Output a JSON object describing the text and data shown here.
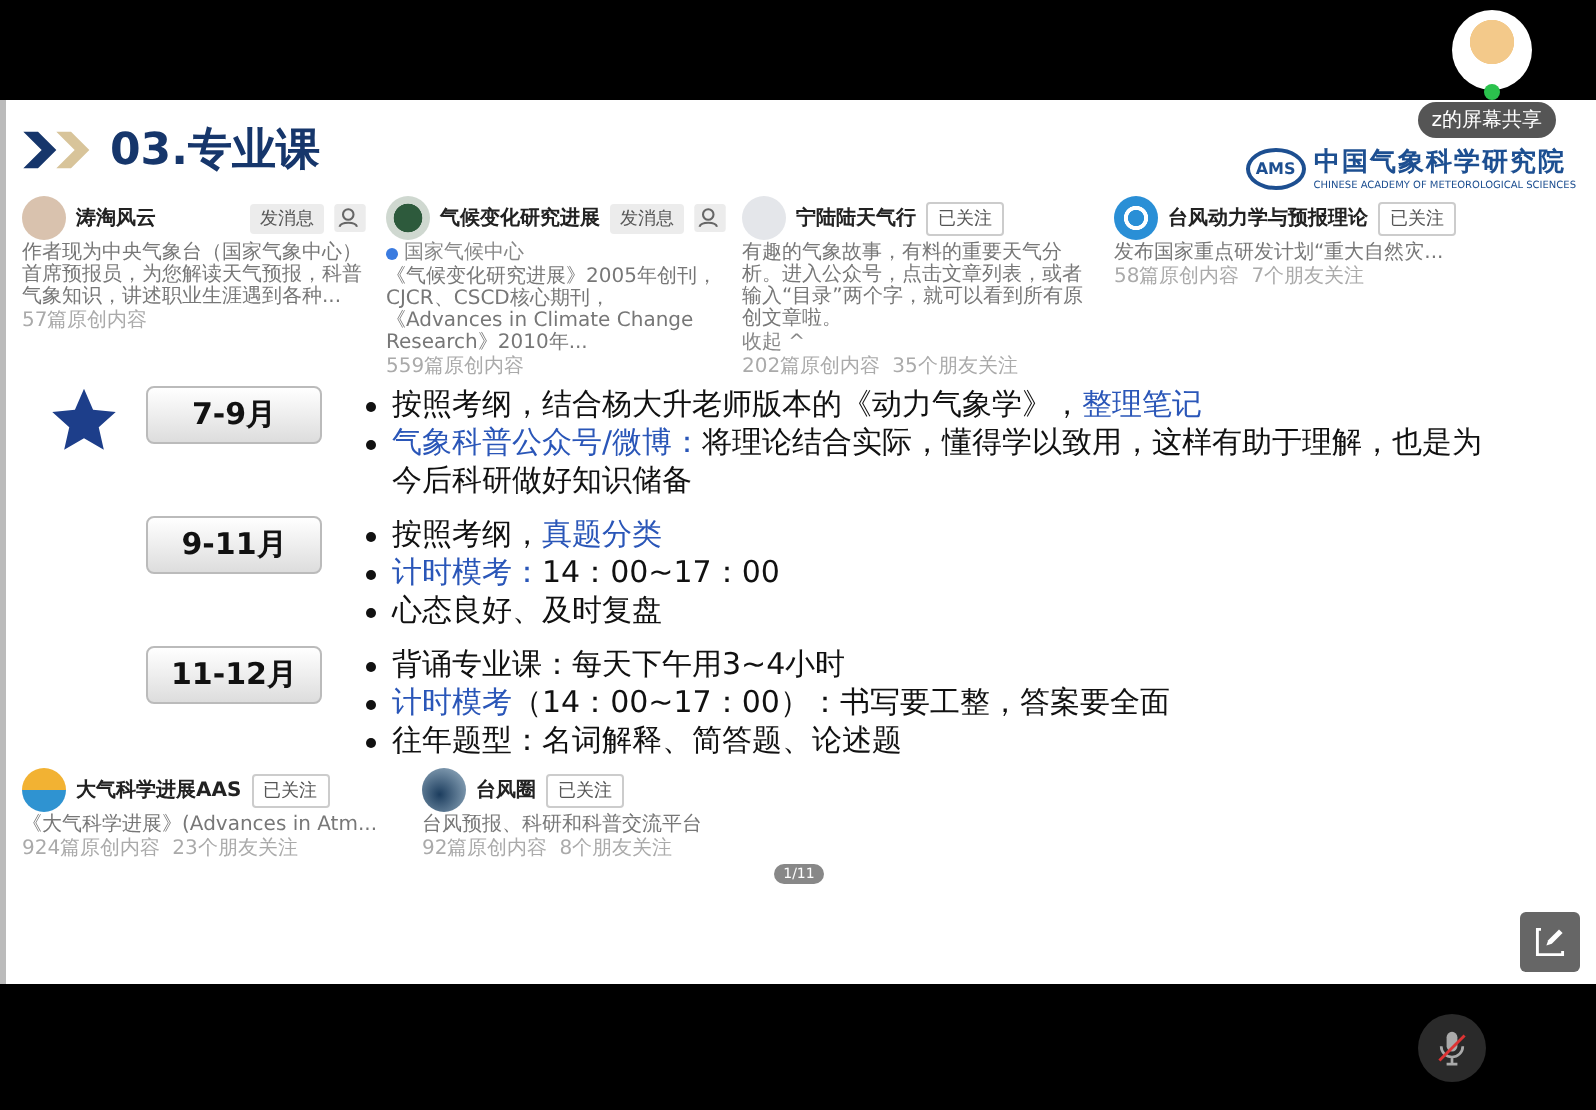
{
  "meeting": {
    "presenter_label": "z的屏幕共享",
    "presenter_mic_on": true,
    "self_mic_muted": true
  },
  "slide": {
    "title": "03.专业课",
    "logo_badge": "AMS",
    "logo_text": "中国气象科学研究院",
    "logo_subtext": "CHINESE ACADEMY OF METEOROLOGICAL SCIENCES",
    "top_cards": [
      {
        "name": "涛淘风云",
        "kind": "photo",
        "action": "发消息",
        "profile_button": true,
        "description": "作者现为中央气象台（国家气象中心）首席预报员，为您解读天气预报，科普气象知识，讲述职业生涯遇到各种...",
        "stats": [
          "57篇原创内容"
        ]
      },
      {
        "name": "气候变化研究进展",
        "kind": "emblem",
        "action": "发消息",
        "profile_button": true,
        "verified": "国家气候中心",
        "description": "《气候变化研究进展》2005年创刊，CJCR、CSCD核心期刊，《Advances in Climate Change Research》2010年...",
        "stats": [
          "559篇原创内容"
        ]
      },
      {
        "name": "宁陆陆天气行",
        "kind": "sketch",
        "action": "已关注",
        "profile_button": false,
        "description": "有趣的气象故事，有料的重要天气分析。进入公众号，点击文章列表，或者输入“目录”两个字，就可以看到所有原创文章啦。",
        "collapse": "收起 ^",
        "stats": [
          "202篇原创内容",
          "35个朋友关注"
        ]
      },
      {
        "name": "台风动力学与预报理论",
        "kind": "typhoon",
        "action": "已关注",
        "profile_button": false,
        "description": "发布国家重点研发计划“重大自然灾...",
        "stats": [
          "58篇原创内容",
          "7个朋友关注"
        ]
      }
    ],
    "periods": [
      {
        "label": "7-9月",
        "starred": true,
        "bullets": [
          [
            {
              "text": "按照考纲，结合杨大升老师版本的《动力气象学》，",
              "accent": false
            },
            {
              "text": "整理笔记",
              "accent": true
            }
          ],
          [
            {
              "text": "气象科普公众号/微博：",
              "accent": true
            },
            {
              "text": "将理论结合实际，懂得学以致用，这样有助于理解，也是为今后科研做好知识储备",
              "accent": false
            }
          ]
        ]
      },
      {
        "label": "9-11月",
        "starred": false,
        "bullets": [
          [
            {
              "text": "按照考纲，",
              "accent": false
            },
            {
              "text": "真题分类",
              "accent": true
            }
          ],
          [
            {
              "text": "计时模考：",
              "accent": true
            },
            {
              "text": "14：00~17：00",
              "accent": false
            }
          ],
          [
            {
              "text": "心态良好、及时复盘",
              "accent": false
            }
          ]
        ]
      },
      {
        "label": "11-12月",
        "starred": false,
        "bullets": [
          [
            {
              "text": "背诵专业课：每天下午用3~4小时",
              "accent": false
            }
          ],
          [
            {
              "text": "计时模考",
              "accent": true
            },
            {
              "text": "（14：00~17：00）：书写要工整，答案要全面",
              "accent": false
            }
          ],
          [
            {
              "text": "往年题型：名词解释、简答题、论述题",
              "accent": false
            }
          ]
        ]
      }
    ],
    "bottom_cards": [
      {
        "name": "大气科学进展AAS",
        "kind": "aas",
        "action": "已关注",
        "profile_button": false,
        "description": "《大气科学进展》(Advances in Atm...",
        "stats": [
          "924篇原创内容",
          "23个朋友关注"
        ]
      },
      {
        "name": "台风圈",
        "kind": "wave",
        "action": "已关注",
        "profile_button": false,
        "description": "台风预报、科研和科普交流平台",
        "stats": [
          "92篇原创内容",
          "8个朋友关注"
        ]
      }
    ],
    "page_indicator": "1/11"
  }
}
